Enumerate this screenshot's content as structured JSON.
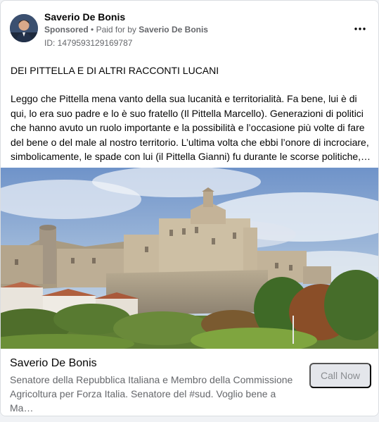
{
  "post": {
    "author_name": "Saverio De Bonis",
    "sponsored_label": "Sponsored",
    "separator": "•",
    "paid_for_prefix": "Paid for by",
    "paid_for_name": "Saverio De Bonis",
    "ad_id": "ID: 1479593129169787",
    "more_icon": "more-horizontal-icon",
    "headline": "DEI PITTELLA E DI ALTRI RACCONTI LUCANI",
    "paragraph_lines": [
      "Leggo che Pittella mena vanto della sua lucanità e territorialità. Fa bene, lui è di",
      "qui, lo era suo padre e lo è suo fratello (Il Pittella Marcello). Generazioni di politici",
      "che hanno avuto un ruolo importante e la possibilità e l’occasione più volte di fare",
      "del bene o del male al nostro territorio. L’ultima volta che ebbi l’onore di incrociare,",
      "simbolicamente, le spade con lui (il Pittella Gianni) fu durante le scorse politiche,…"
    ]
  },
  "footer": {
    "title": "Saverio De Bonis",
    "desc_lines": [
      "Senatore della Repubblica Italiana e Membro della Commissione",
      "Agricoltura per Forza Italia. Senatore del #sud. Voglio bene a Ma…"
    ],
    "cta_label": "Call Now"
  }
}
